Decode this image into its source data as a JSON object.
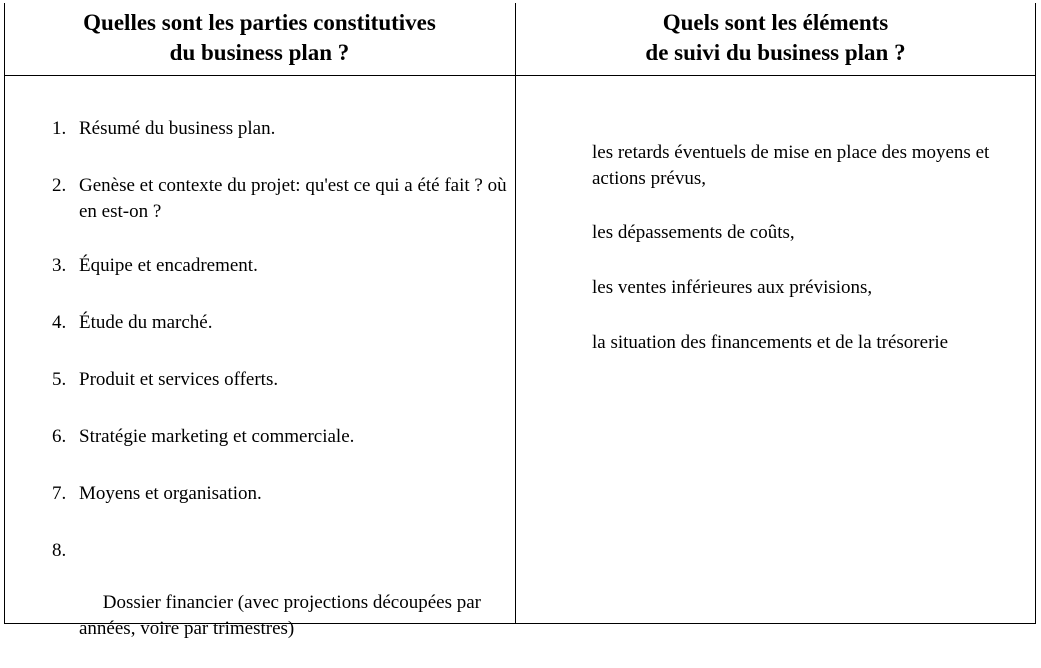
{
  "left_column": {
    "heading_line1": "Quelles sont les parties constitutives",
    "heading_line2": "du business plan ?",
    "items": [
      {
        "num": "1.",
        "text": "Résumé du business plan."
      },
      {
        "num": "2.",
        "text": "Genèse et contexte du projet: qu'est ce qui a été fait ? où en est-on ?"
      },
      {
        "num": "3.",
        "text": "Équipe et encadrement."
      },
      {
        "num": "4.",
        "text": "Étude du marché."
      },
      {
        "num": "5.",
        "text": "Produit et services offerts."
      },
      {
        "num": "6.",
        "text": "Stratégie marketing et commerciale."
      },
      {
        "num": "7.",
        "text": "Moyens et organisation."
      },
      {
        "num": "8.",
        "text": " Dossier financier (avec projections découpées par années, voire par trimestres)"
      }
    ]
  },
  "right_column": {
    "heading_line1": "Quels sont les éléments",
    "heading_line2": "de suivi du business plan ?",
    "items": [
      "les retards éventuels de mise en place des moyens et actions prévus,",
      "les dépassements de coûts,",
      "les ventes inférieures aux prévisions,",
      "la situation des financements et de la trésorerie"
    ]
  }
}
